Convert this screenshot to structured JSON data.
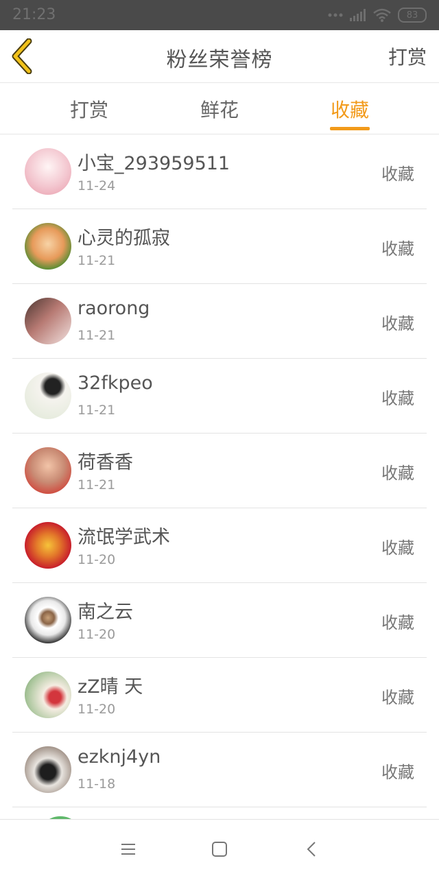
{
  "status_bar": {
    "time": "21:23",
    "battery": "83",
    "icons": [
      "dots-icon",
      "signal-icon",
      "wifi-icon",
      "battery-icon"
    ]
  },
  "header": {
    "title": "粉丝荣誉榜",
    "back_icon": "chevron-left-icon",
    "action_label": "打赏"
  },
  "tabs": [
    {
      "label": "打赏",
      "active": false
    },
    {
      "label": "鲜花",
      "active": false
    },
    {
      "label": "收藏",
      "active": true
    }
  ],
  "accent_color": "#f29a1a",
  "list": [
    {
      "name": "小宝_293959511",
      "date": "11-24",
      "action": "收藏",
      "avatar_color": "#f3c6cf"
    },
    {
      "name": "心灵的孤寂",
      "date": "11-21",
      "action": "收藏",
      "avatar_color": "#e79a5a"
    },
    {
      "name": "raorong",
      "date": "11-21",
      "action": "收藏",
      "avatar_color": "#b77a73"
    },
    {
      "name": "32fkpeo",
      "date": "11-21",
      "action": "收藏",
      "avatar_color": "#dfe8d6"
    },
    {
      "name": "荷香香",
      "date": "11-21",
      "action": "收藏",
      "avatar_color": "#c98b74"
    },
    {
      "name": "流氓学武术",
      "date": "11-20",
      "action": "收藏",
      "avatar_color": "#c8202b"
    },
    {
      "name": "南之云",
      "date": "11-20",
      "action": "收藏",
      "avatar_color": "#3a3a3a"
    },
    {
      "name": "zZ晴 天",
      "date": "11-20",
      "action": "收藏",
      "avatar_color": "#a9c59b"
    },
    {
      "name": "ezknj4yn",
      "date": "11-18",
      "action": "收藏",
      "avatar_color": "#6b5446"
    }
  ],
  "nav": {
    "icons": [
      "menu-icon",
      "home-square-icon",
      "back-triangle-icon"
    ]
  }
}
